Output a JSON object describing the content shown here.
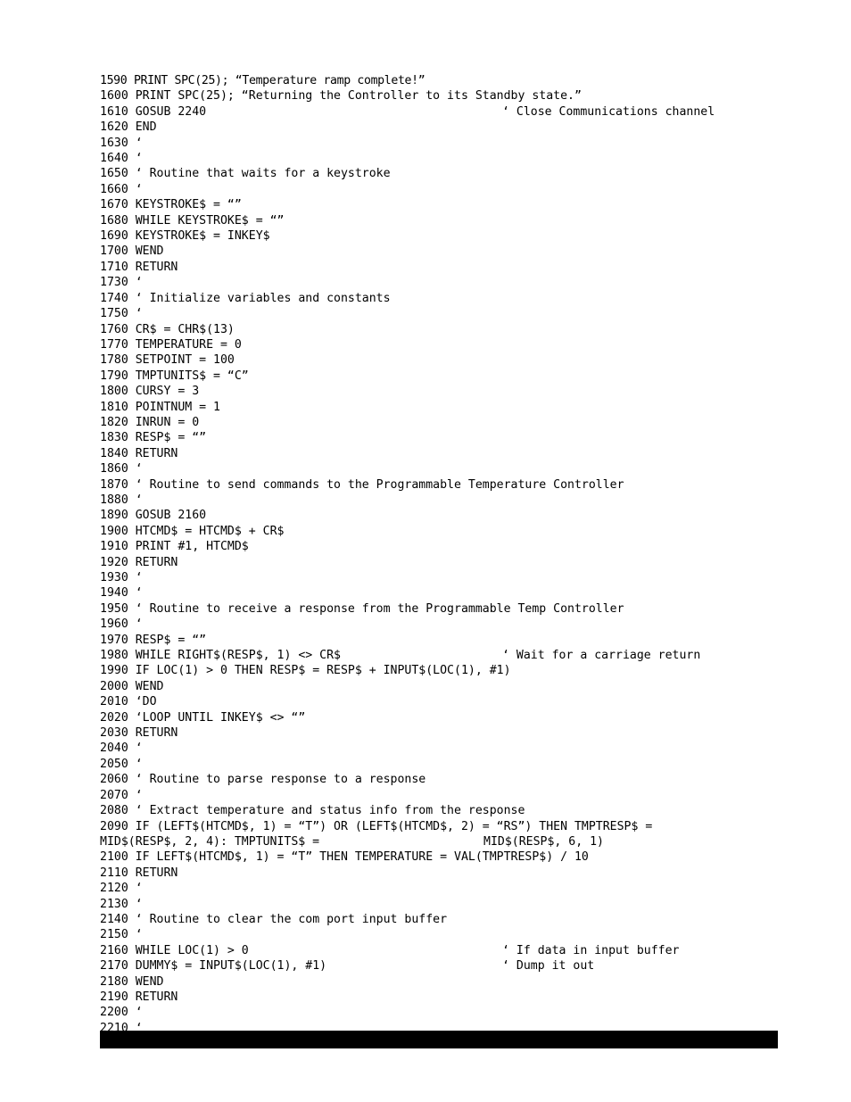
{
  "page": {
    "background_color": "#ffffff",
    "text_color": "#000000",
    "bottom_bar_color": "#000000"
  },
  "listing": {
    "language": "BASIC",
    "first_line_number": "1590",
    "last_line_number": "2210",
    "lines": [
      {
        "num": "1590",
        "body": "PRINT SPC(25); “Temperature ramp complete!”",
        "trail": "",
        "tight": true
      },
      {
        "num": "1600",
        "body": "PRINT SPC(25); “Returning the Controller to its Standby state.”",
        "trail": ""
      },
      {
        "num": "1610",
        "body": "GOSUB 2240",
        "trail": "‘ Close Communications channel"
      },
      {
        "num": "1620",
        "body": "END",
        "trail": ""
      },
      {
        "num": "1630",
        "body": "‘",
        "trail": ""
      },
      {
        "num": "1640",
        "body": "‘",
        "trail": ""
      },
      {
        "num": "1650",
        "body": "‘ Routine that waits for a keystroke",
        "trail": ""
      },
      {
        "num": "1660",
        "body": "‘",
        "trail": ""
      },
      {
        "num": "1670",
        "body": "KEYSTROKE$ = “”",
        "trail": ""
      },
      {
        "num": "1680",
        "body": "WHILE KEYSTROKE$ = “”",
        "trail": ""
      },
      {
        "num": "1690",
        "body": "KEYSTROKE$ = INKEY$",
        "trail": ""
      },
      {
        "num": "1700",
        "body": "WEND",
        "trail": ""
      },
      {
        "num": "1710",
        "body": "RETURN",
        "trail": ""
      },
      {
        "num": "1730",
        "body": "‘",
        "trail": ""
      },
      {
        "num": "1740",
        "body": "‘ Initialize variables and constants",
        "trail": ""
      },
      {
        "num": "1750",
        "body": "‘",
        "trail": ""
      },
      {
        "num": "1760",
        "body": "CR$ = CHR$(13)",
        "trail": ""
      },
      {
        "num": "1770",
        "body": "TEMPERATURE = 0",
        "trail": ""
      },
      {
        "num": "1780",
        "body": "SETPOINT = 100",
        "trail": ""
      },
      {
        "num": "1790",
        "body": "TMPTUNITS$ = “C”",
        "trail": ""
      },
      {
        "num": "1800",
        "body": "CURSY = 3",
        "trail": ""
      },
      {
        "num": "1810",
        "body": "POINTNUM = 1",
        "trail": ""
      },
      {
        "num": "1820",
        "body": "INRUN = 0",
        "trail": ""
      },
      {
        "num": "1830",
        "body": "RESP$ = “”",
        "trail": ""
      },
      {
        "num": "1840",
        "body": "RETURN",
        "trail": ""
      },
      {
        "num": "1860",
        "body": "‘",
        "trail": ""
      },
      {
        "num": "1870",
        "body": "‘ Routine to send commands to the Programmable Temperature Controller",
        "trail": ""
      },
      {
        "num": "1880",
        "body": "‘",
        "trail": ""
      },
      {
        "num": "1890",
        "body": "GOSUB 2160",
        "trail": ""
      },
      {
        "num": "1900",
        "body": "HTCMD$ = HTCMD$ + CR$",
        "trail": ""
      },
      {
        "num": "1910",
        "body": "PRINT #1, HTCMD$",
        "trail": ""
      },
      {
        "num": "1920",
        "body": "RETURN",
        "trail": ""
      },
      {
        "num": "1930",
        "body": "‘",
        "trail": ""
      },
      {
        "num": "1940",
        "body": "‘",
        "trail": ""
      },
      {
        "num": "1950",
        "body": "‘ Routine to receive a response from the Programmable Temp Controller",
        "trail": ""
      },
      {
        "num": "1960",
        "body": "‘",
        "trail": ""
      },
      {
        "num": "1970",
        "body": "RESP$ = “”",
        "trail": ""
      },
      {
        "num": "1980",
        "body": "WHILE RIGHT$(RESP$, 1) <> CR$",
        "trail": "‘ Wait for a carriage return"
      },
      {
        "num": "1990",
        "body": "IF LOC(1) > 0 THEN RESP$ = RESP$ + INPUT$(LOC(1), #1)",
        "trail": ""
      },
      {
        "num": "2000",
        "body": "WEND",
        "trail": ""
      },
      {
        "num": "2010",
        "body": "‘DO",
        "trail": ""
      },
      {
        "num": "2020",
        "body": "‘LOOP UNTIL INKEY$ <> “”",
        "trail": ""
      },
      {
        "num": "2030",
        "body": "RETURN",
        "trail": ""
      },
      {
        "num": "2040",
        "body": "‘",
        "trail": ""
      },
      {
        "num": "2050",
        "body": "‘",
        "trail": ""
      },
      {
        "num": "2060",
        "body": "‘ Routine to parse response to a response",
        "trail": ""
      },
      {
        "num": "2070",
        "body": "‘",
        "trail": ""
      },
      {
        "num": "2080",
        "body": "‘ Extract temperature and status info from the response",
        "trail": ""
      },
      {
        "num": "2090",
        "body": "IF (LEFT$(HTCMD$, 1) = “T”) OR (LEFT$(HTCMD$, 2) = “RS”) THEN TMPTRESP$ =",
        "trail": ""
      },
      {
        "num": "",
        "body": "MID$(RESP$, 2, 4): TMPTUNITS$ =",
        "trail": "MID$(RESP$, 6, 1)",
        "continuation": true
      },
      {
        "num": "2100",
        "body": "IF LEFT$(HTCMD$, 1) = “T” THEN TEMPERATURE = VAL(TMPTRESP$) / 10",
        "trail": ""
      },
      {
        "num": "2110",
        "body": "RETURN",
        "trail": ""
      },
      {
        "num": "2120",
        "body": "‘",
        "trail": ""
      },
      {
        "num": "2130",
        "body": "‘",
        "trail": ""
      },
      {
        "num": "2140",
        "body": "‘ Routine to clear the com port input buffer",
        "trail": ""
      },
      {
        "num": "2150",
        "body": "‘",
        "trail": ""
      },
      {
        "num": "2160",
        "body": "WHILE LOC(1) > 0",
        "trail": "‘ If data in input buffer"
      },
      {
        "num": "2170",
        "body": "DUMMY$ = INPUT$(LOC(1), #1)",
        "trail": "‘ Dump it out"
      },
      {
        "num": "2180",
        "body": "WEND",
        "trail": ""
      },
      {
        "num": "2190",
        "body": "RETURN",
        "trail": ""
      },
      {
        "num": "2200",
        "body": "‘",
        "trail": ""
      },
      {
        "num": "2210",
        "body": "‘",
        "trail": ""
      }
    ]
  }
}
